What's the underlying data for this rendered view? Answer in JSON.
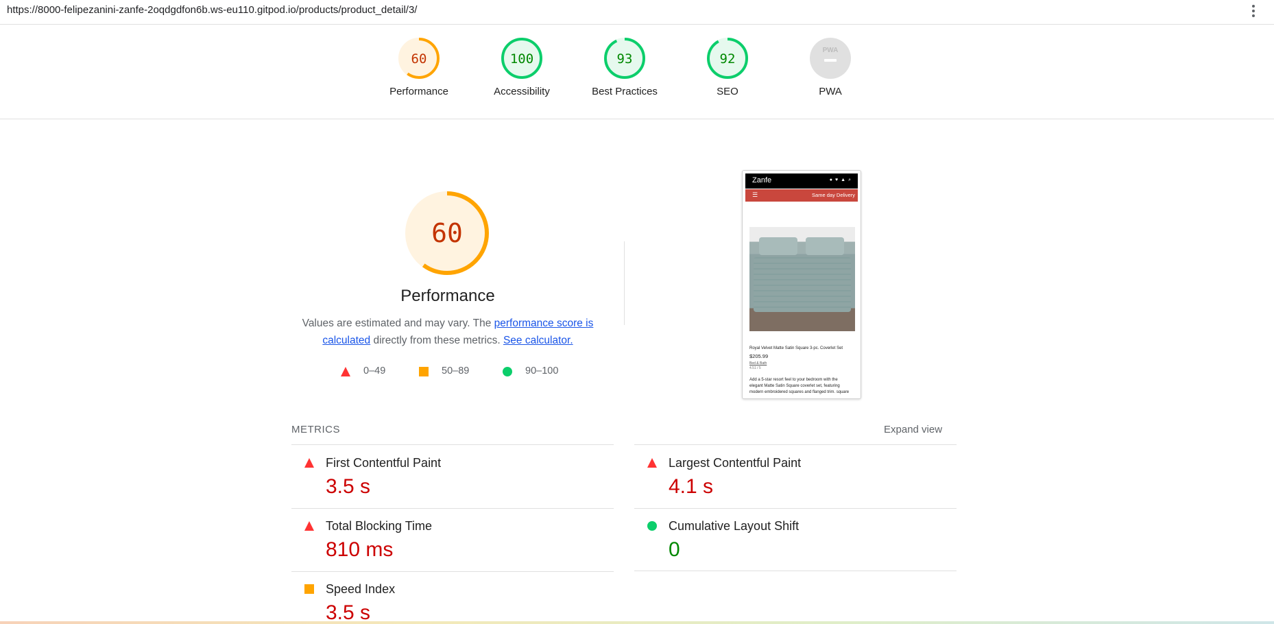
{
  "browser": {
    "url": "https://8000-felipezanini-zanfe-2oqdgdfon6b.ws-eu110.gitpod.io/products/product_detail/3/"
  },
  "colors": {
    "fail": "#ff3333",
    "average": "#ffa400",
    "pass": "#0cce6b",
    "fail_text": "#cc0000",
    "pass_text": "#008800",
    "link": "#1a55e8"
  },
  "gauges": [
    {
      "label": "Performance",
      "score": "60",
      "status": "average"
    },
    {
      "label": "Accessibility",
      "score": "100",
      "status": "pass"
    },
    {
      "label": "Best Practices",
      "score": "93",
      "status": "pass"
    },
    {
      "label": "SEO",
      "score": "92",
      "status": "pass"
    },
    {
      "label": "PWA",
      "score": "",
      "status": "na"
    }
  ],
  "performance": {
    "score": "60",
    "score_fraction": 0.6,
    "title": "Performance",
    "desc_pre": "Values are estimated and may vary. The ",
    "desc_link1": "performance score is calculated",
    "desc_mid": " directly from these metrics. ",
    "desc_link2": "See calculator.",
    "legend": [
      {
        "range": "0–49",
        "icon": "triangle-fail-icon"
      },
      {
        "range": "50–89",
        "icon": "square-average-icon"
      },
      {
        "range": "90–100",
        "icon": "circle-pass-icon"
      }
    ]
  },
  "screenshot": {
    "brand": "Zanfe",
    "banner": "Same day Delivery",
    "product": "Royal Velvet Matte Satin Square 3-pc. Coverlet Set",
    "price": "$205.99",
    "category": "Bed & Bath",
    "rating": "4.51 / 5",
    "desc1": "Add a 5-star resort feel to your bedroom with the",
    "desc2": "elegant Matte Satin Square coverlet set, featuring",
    "desc3": "modern embroidered squares and flanged trim. square"
  },
  "metrics": {
    "header": "METRICS",
    "expand": "Expand view",
    "items": [
      {
        "name": "First Contentful Paint",
        "value": "3.5 s",
        "status": "fail"
      },
      {
        "name": "Largest Contentful Paint",
        "value": "4.1 s",
        "status": "fail"
      },
      {
        "name": "Total Blocking Time",
        "value": "810 ms",
        "status": "fail"
      },
      {
        "name": "Cumulative Layout Shift",
        "value": "0",
        "status": "pass"
      },
      {
        "name": "Speed Index",
        "value": "3.5 s",
        "status": "average"
      }
    ]
  }
}
